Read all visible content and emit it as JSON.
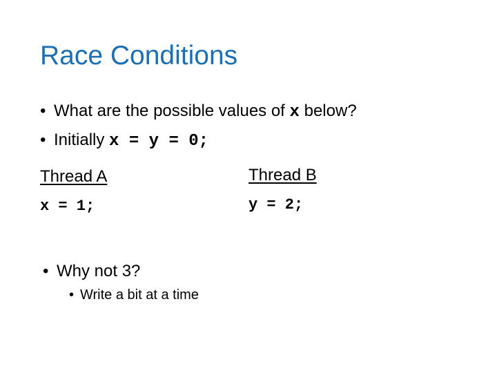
{
  "slide": {
    "title": "Race Conditions",
    "bullets": [
      {
        "bullet": "•",
        "text": "What are the possible values of ",
        "code": "x",
        "suffix": " below?"
      },
      {
        "bullet": "•",
        "text": "Initially ",
        "code": "x = y = 0;"
      }
    ],
    "threads": [
      {
        "label": "Thread A",
        "code": "x = 1;"
      },
      {
        "label": "Thread B",
        "code": "y = 2;"
      }
    ],
    "question": {
      "bullet": "•",
      "text": "Why not 3?"
    },
    "sub_bullet": {
      "bullet": "•",
      "text": "Write a bit at a time"
    },
    "colors": {
      "title": "#1a6fb5",
      "text": "#000000",
      "background": "#ffffff"
    }
  }
}
